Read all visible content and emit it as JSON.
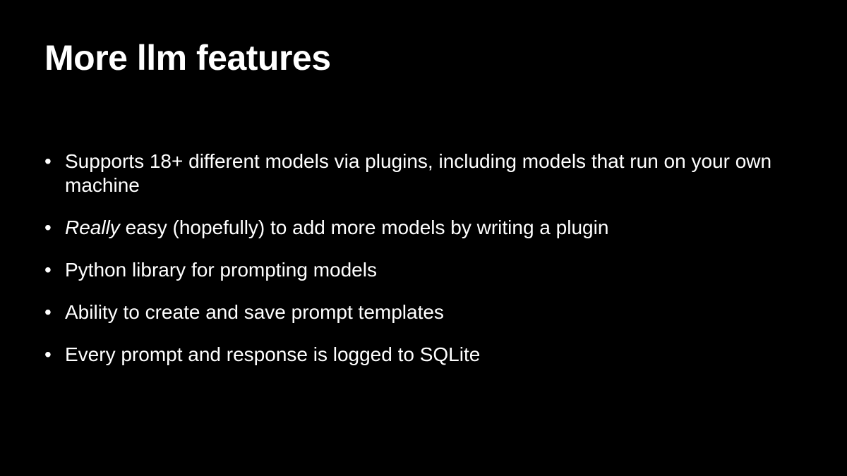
{
  "slide": {
    "title": "More llm features",
    "bullet_glyph": "•",
    "bullets": [
      {
        "text": "Supports 18+ different models via plugins, including models that run on your own machine"
      },
      {
        "emphasis": "Really",
        "text": " easy (hopefully) to add more models by writing a plugin"
      },
      {
        "text": "Python library for prompting models"
      },
      {
        "text": "Ability to create and save prompt templates"
      },
      {
        "text": "Every prompt and response is logged to SQLite"
      }
    ]
  },
  "colors": {
    "background": "#000000",
    "text": "#ffffff"
  }
}
